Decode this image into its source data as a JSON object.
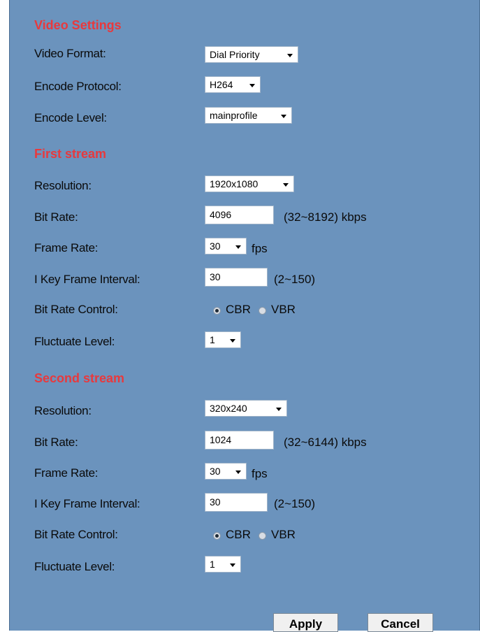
{
  "video_settings": {
    "title": "Video Settings",
    "video_format": {
      "label": "Video Format:",
      "value": "Dial Priority"
    },
    "encode_protocol": {
      "label": "Encode Protocol:",
      "value": "H264"
    },
    "encode_level": {
      "label": "Encode Level:",
      "value": "mainprofile"
    }
  },
  "first_stream": {
    "title": "First stream",
    "resolution": {
      "label": "Resolution:",
      "value": "1920x1080"
    },
    "bit_rate": {
      "label": "Bit Rate:",
      "value": "4096",
      "range": "(32~8192) kbps"
    },
    "frame_rate": {
      "label": "Frame Rate:",
      "value": "30",
      "unit": "fps"
    },
    "i_key_frame_interval": {
      "label": "I Key Frame Interval:",
      "value": "30",
      "range": "(2~150)"
    },
    "bit_rate_control": {
      "label": "Bit Rate Control:",
      "options": [
        "CBR",
        "VBR"
      ],
      "selected": "CBR"
    },
    "fluctuate_level": {
      "label": "Fluctuate Level:",
      "value": "1"
    }
  },
  "second_stream": {
    "title": "Second stream",
    "resolution": {
      "label": "Resolution:",
      "value": "320x240"
    },
    "bit_rate": {
      "label": "Bit Rate:",
      "value": "1024",
      "range": "(32~6144) kbps"
    },
    "frame_rate": {
      "label": "Frame Rate:",
      "value": "30",
      "unit": "fps"
    },
    "i_key_frame_interval": {
      "label": "I Key Frame Interval:",
      "value": "30",
      "range": "(2~150)"
    },
    "bit_rate_control": {
      "label": "Bit Rate Control:",
      "options": [
        "CBR",
        "VBR"
      ],
      "selected": "CBR"
    },
    "fluctuate_level": {
      "label": "Fluctuate Level:",
      "value": "1"
    }
  },
  "buttons": {
    "apply": "Apply",
    "cancel": "Cancel"
  },
  "colors": {
    "panel_bg": "#6b93bd",
    "section_title": "#e8393d"
  }
}
